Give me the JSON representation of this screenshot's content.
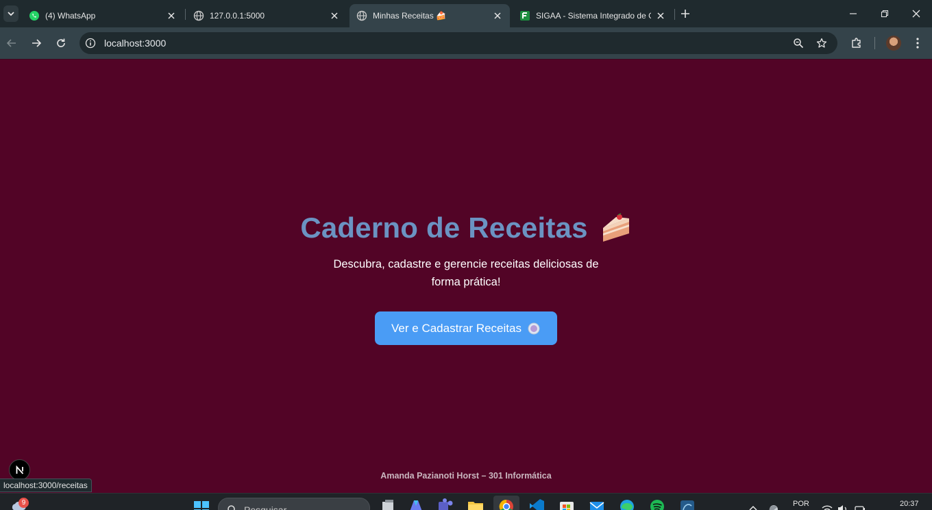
{
  "browser": {
    "tabs": [
      {
        "title": "(4) WhatsApp",
        "icon": "whatsapp-icon",
        "active": false
      },
      {
        "title": "127.0.0.1:5000",
        "icon": "globe-icon",
        "active": false
      },
      {
        "title": "Minhas Receitas 🍰",
        "icon": "globe-icon",
        "active": true
      },
      {
        "title": "SIGAA - Sistema Integrado de G",
        "icon": "sigaa-icon",
        "active": false
      }
    ],
    "address": "localhost:3000",
    "status_url": "localhost:3000/receitas"
  },
  "page": {
    "title": "Caderno de Receitas",
    "subtitle": "Descubra, cadastre e gerencie receitas deliciosas de forma prática!",
    "cta_label": "Ver e Cadastrar Receitas",
    "footer": "Amanda Pazianoti Horst – 301 Informática",
    "colors": {
      "background": "#520426",
      "title": "#6b93c2",
      "button": "#4a9cf5"
    }
  },
  "taskbar": {
    "weather_badge": "9",
    "search_placeholder": "Pesquisar",
    "language": "POR",
    "time": "20:37"
  }
}
